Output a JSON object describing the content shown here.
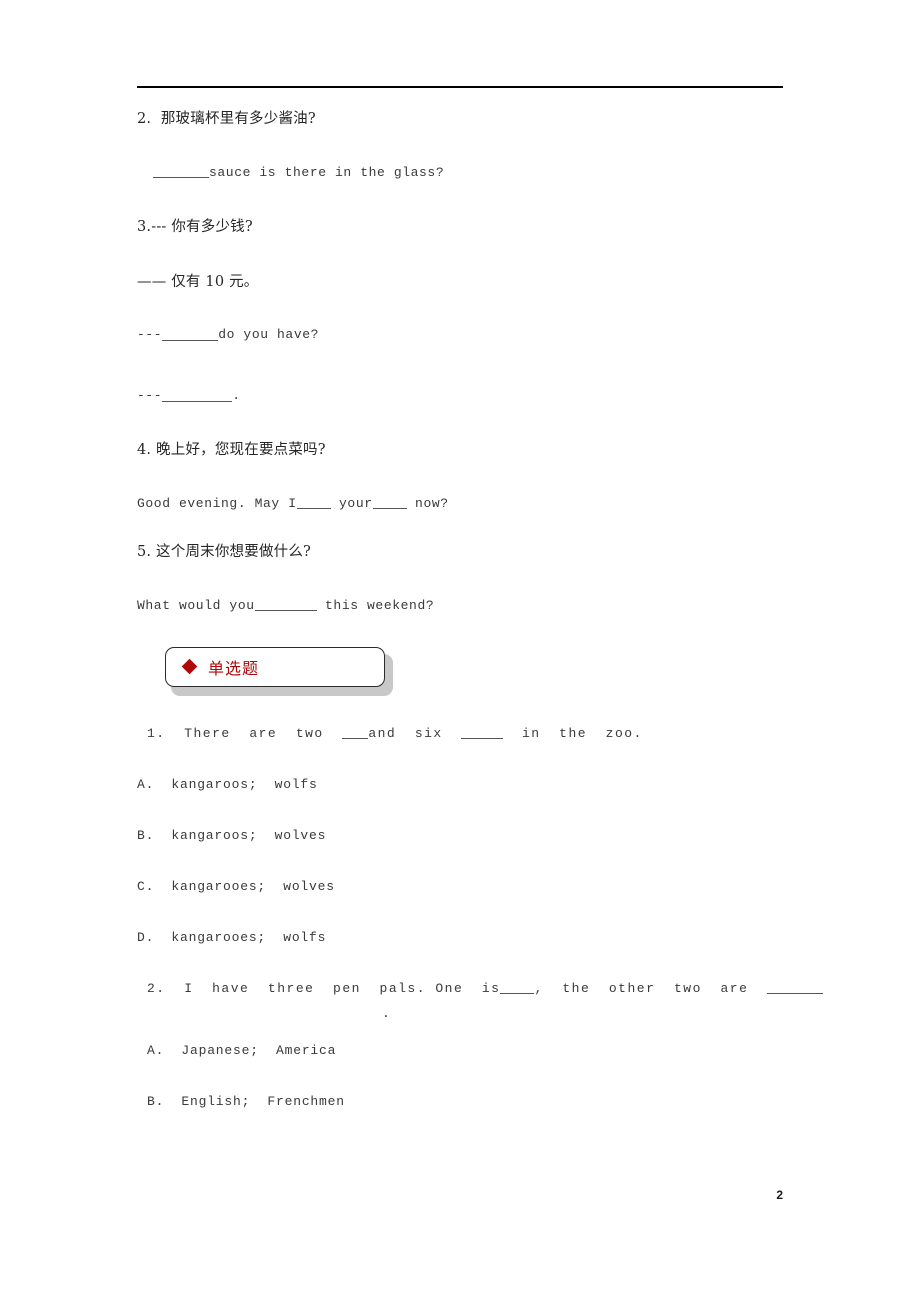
{
  "document": {
    "page_number": "2",
    "accent_color": "#b00808",
    "rule_color": "#000000"
  },
  "translation_section": {
    "items": [
      {
        "id": "q2",
        "number": "2.",
        "chinese": "2.  那玻璃杯里有多少酱油?",
        "english_prefix": "",
        "english_suffix": "sauce is there in the glass?"
      },
      {
        "id": "q3",
        "number": "3.",
        "chinese": "3.--- 你有多少钱?",
        "chinese_answer": "—— 仅有 10 元。",
        "english_prefix": "---",
        "english_suffix": "do you have?",
        "english_answer_prefix": "---",
        "english_answer_suffix": "."
      },
      {
        "id": "q4",
        "number": "4.",
        "chinese": "4. 晚上好，您现在要点菜吗?",
        "english_part1": "Good evening. May I",
        "english_part2": " your",
        "english_part3": " now?"
      },
      {
        "id": "q5",
        "number": "5.",
        "chinese": "5. 这个周末你想要做什么?",
        "english_part1": "What would you",
        "english_part2": " this weekend?"
      }
    ]
  },
  "mc_section": {
    "badge_icon": "red-diamond-bullet",
    "badge_label": "单选题",
    "questions": [
      {
        "number": "1.",
        "stem_part1": "1.  There  are  two  ",
        "stem_part2": "and  six  ",
        "stem_part3": "  in  the  zoo.",
        "stem_tail": "",
        "options": [
          {
            "letter": "A.",
            "text": "A.  kangaroos;  wolfs"
          },
          {
            "letter": "B.",
            "text": "B.  kangaroos;  wolves"
          },
          {
            "letter": "C.",
            "text": "C.  kangarooes;  wolves"
          },
          {
            "letter": "D.",
            "text": "D.  kangarooes;  wolfs"
          }
        ]
      },
      {
        "number": "2.",
        "stem_part1": "2.  I  have  three  pen  pals. One  is",
        "stem_part2": ",  the  other  two  are  ",
        "stem_part3": "",
        "stem_tail": ".",
        "options": [
          {
            "letter": "A.",
            "text": "A.  Japanese;  America"
          },
          {
            "letter": "B.",
            "text": "B.  English;  Frenchmen"
          }
        ]
      }
    ]
  }
}
